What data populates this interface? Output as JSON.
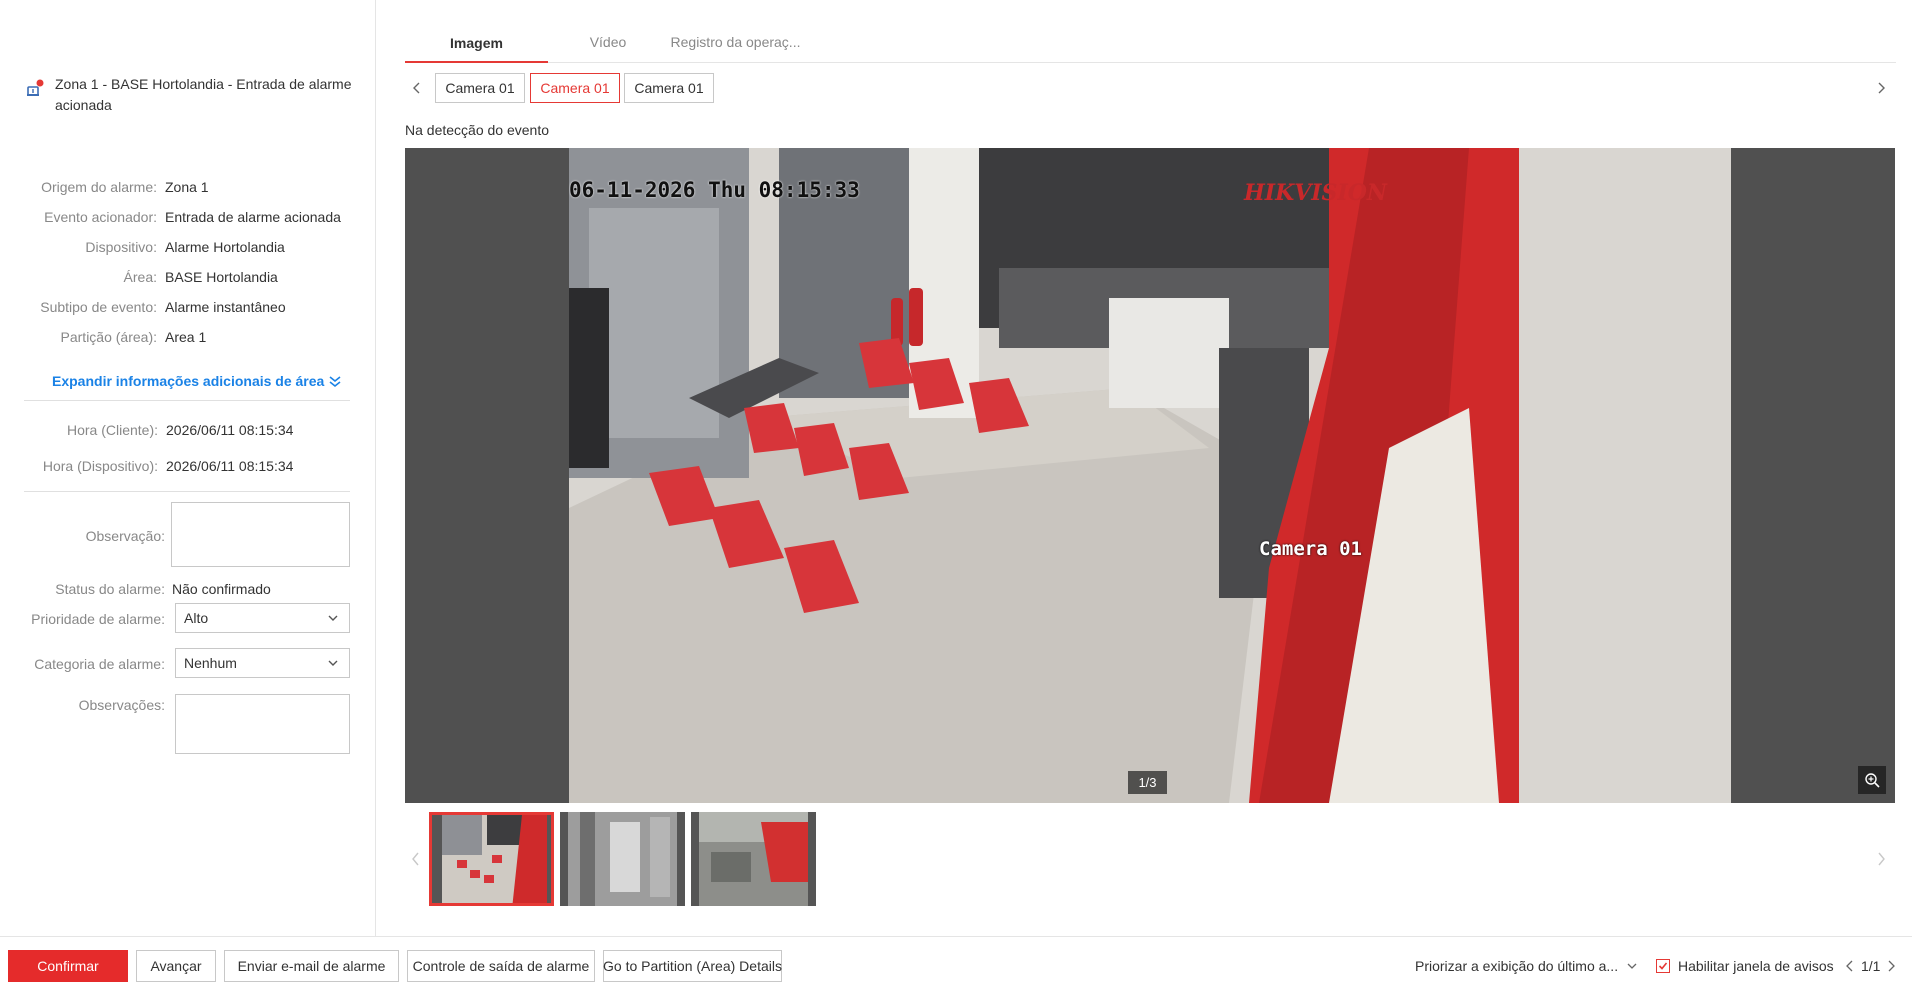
{
  "alarm": {
    "title": "Zona 1 - BASE Hortolandia - Entrada de alarme acionada"
  },
  "details": [
    {
      "label": "Origem do alarme:",
      "value": "Zona 1"
    },
    {
      "label": "Evento acionador:",
      "value": "Entrada de alarme acionada"
    },
    {
      "label": "Dispositivo:",
      "value": "Alarme Hortolandia"
    },
    {
      "label": "Área:",
      "value": "BASE Hortolandia"
    },
    {
      "label": "Subtipo de evento:",
      "value": "Alarme instantâneo"
    },
    {
      "label": "Partição (área):",
      "value": "Area 1"
    }
  ],
  "expand_link": "Expandir informações adicionais de área",
  "times": {
    "client_label": "Hora (Cliente):",
    "client_value": "2026/06/11 08:15:34",
    "device_label": "Hora (Dispositivo):",
    "device_value": "2026/06/11 08:15:34"
  },
  "form": {
    "observation_label": "Observação:",
    "observation_value": "",
    "status_label": "Status do alarme:",
    "status_value": "Não confirmado",
    "priority_label": "Prioridade de alarme:",
    "priority_value": "Alto",
    "category_label": "Categoria de alarme:",
    "category_value": "Nenhum",
    "notes_label": "Observações:",
    "notes_value": ""
  },
  "tabs": [
    "Imagem",
    "Vídeo",
    "Registro da operaç..."
  ],
  "active_tab": 0,
  "cameras": [
    "Camera 01",
    "Camera 01",
    "Camera 01"
  ],
  "active_camera": 1,
  "section_label": "Na detecção do evento",
  "snapshot": {
    "osd_datetime": "06-11-2026 Thu 08:15:33",
    "osd_brand": "HIKVISION",
    "osd_camera": "Camera 01",
    "counter": "1/3"
  },
  "thumbnails_count": 3,
  "active_thumbnail": 0,
  "bottom": {
    "confirm": "Confirmar",
    "next": "Avançar",
    "email": "Enviar e-mail de alarme",
    "output_control": "Controle de saída de alarme",
    "partition": "Go to Partition (Area) Details",
    "priority_dropdown": "Priorizar a exibição do último a...",
    "enable_popup": "Habilitar janela de avisos",
    "pagination": "1/1"
  },
  "colors": {
    "accent": "#e53935",
    "link": "#1a82e6",
    "viewer_bg": "#505050"
  }
}
